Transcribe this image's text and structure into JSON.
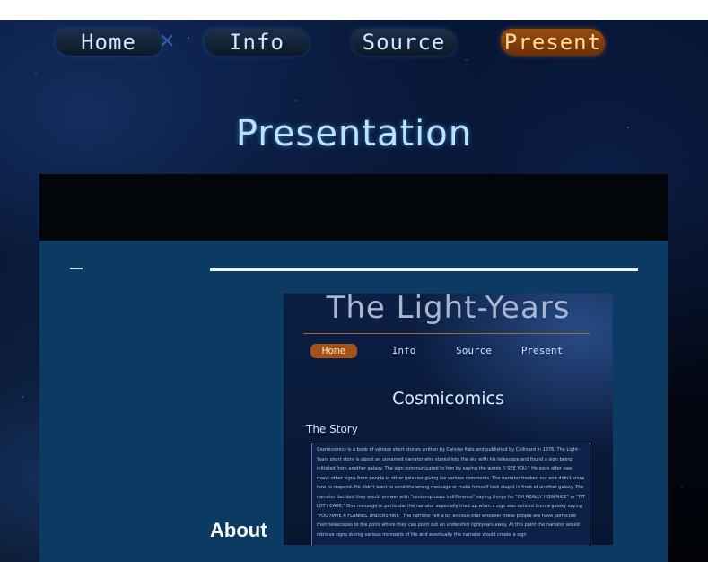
{
  "nav": {
    "items": [
      {
        "label": "Home"
      },
      {
        "label": "Info"
      },
      {
        "label": "Source"
      },
      {
        "label": "Present",
        "active": true
      }
    ],
    "accent": "#9a4d10"
  },
  "page": {
    "title": "Presentation"
  },
  "section": {
    "heading": "About"
  },
  "thumbnail": {
    "title": "The Light-Years",
    "nav": [
      "Home",
      "Info",
      "Source",
      "Present"
    ],
    "subtitle": "Cosmicomics",
    "story_heading": "The Story",
    "story_text": "Cosmicomics is a book of various short stories written by Calvino Italo and published by Collinard in 1976. The Light-Years short story is about an unnamed narrator who stared into the sky with his telescope and found a sign being initiated from another galaxy. The sign communicated to him by saying the words \"I SEE YOU.\" He soon after saw many other signs from people in other galaxies giving his various comments. The narrator freaked out and didn't know how to respond. He didn't want to send the wrong message or make himself look stupid in front of another galaxy. The narrator decided they would answer with \"contemptuous indifference\" saying things for \"OH REALLY HOW NICE\" or \"FIT LOT I CARE.\" One message in particular the narrator especially tried up when a sign was noticed from a galaxy saying \"YOU HAVE A FLANNEL UNDERSHIRT.\" The narrator felt a bit anxious that whoever these people are have perfected their telescopes to the point where they can point out an undershirt lightyears away. At this point the narrator would retrieve signs during various moments of life and eventually the narrator would create a sign"
  }
}
